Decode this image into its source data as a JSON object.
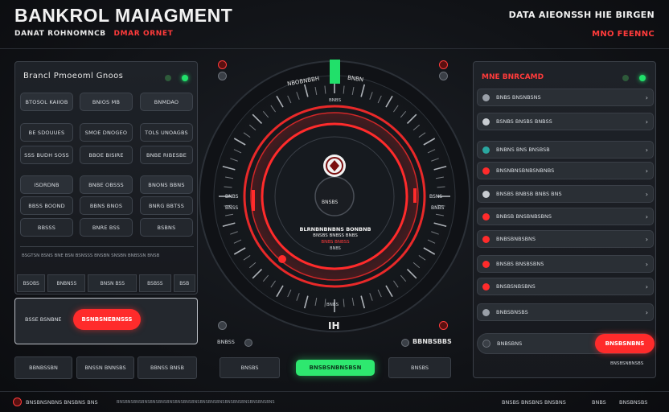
{
  "header": {
    "title": "BANKROL MAIAGMENT",
    "subtitle_white": "DANAT ROHNOMNCB",
    "subtitle_red": "DMAR ORNET",
    "right_top": "DATA AIEONSSH HIE BIRGEN",
    "right_bottom": "MNO FEENNC"
  },
  "left_panel": {
    "title": "Brancl Pmoeoml Gnoos",
    "buttons": [
      "BTOSOL KAIIOB",
      "BNIOS MB",
      "BNMDAO",
      "BE SDOUUES",
      "SMOE DNOGEO",
      "TOLS UNOAGBS",
      "SSS BUDH SOSS",
      "BBOE BISIRE",
      "BNBE RIBESBE",
      "ISDRDNB",
      "BNBE OBSSS",
      "BNONS BBNS",
      "BBSS BOOND",
      "BBNS BNOS",
      "BNRG BBTSS",
      "BBSSS",
      "BNRE BSS",
      "BSBNS"
    ],
    "footnote": "BSGTSN BSNS BNE BSN BSNSSS BNSBN SNSBN BNBSSN BNSB",
    "tabs": [
      "BSOBS",
      "BNBNSS",
      "BNSN BSS",
      "BSBSS",
      "BSB"
    ]
  },
  "action_panel": {
    "label": "BSSE BSNBNE",
    "cta": "BSNBSNEBNSSS"
  },
  "left_bottom_buttons": [
    "BBNBSSBN",
    "BNSSN BNNSBS",
    "BBNSS BNSB"
  ],
  "dial": {
    "top_label": "NBOBNBBH",
    "top_label_right": "BNBN",
    "inner_top": "BNBS",
    "left_label_1": "BNBS",
    "left_label_2": "BNSS",
    "right_label_1": "BSNS",
    "right_label_2": "BNBS",
    "center_label": "BNSBS",
    "readout_1": "BLRNBNBNBNS BONBNB",
    "readout_2": "BNSBS BNBSS BNBS",
    "readout_3": "BNBS BNBSS",
    "readout_4": "BNBS",
    "bottom_small": "BNBS",
    "bottom_big": "IH",
    "accent_red": "#ff2b2b",
    "accent_green": "#21e06a"
  },
  "center_bottom": {
    "left_status": "BNBSS",
    "right_status": "BBNBSBBS",
    "buttons": [
      "BNSBS",
      "BNSBSNBNSBSN",
      "BNSBS"
    ]
  },
  "right_panel": {
    "title": "MNE BNRCAMD",
    "items": [
      {
        "label": "BNBS BNSNBSNS",
        "icon_color": "#9aa0a8"
      },
      {
        "label": "BSNBS    BNSBS BNBSS",
        "icon_color": "#c8ccd1"
      },
      {
        "label": "BNBNS BNS BNSBSB",
        "icon_color": "#2aa7a0"
      },
      {
        "label": "BNSNBNSBNBSNBNBS",
        "icon_color": "#ff2b2b"
      },
      {
        "label": "BNSBS   BNBSB  BNBS BNS",
        "icon_color": "#c8ccd1"
      },
      {
        "label": "BNBSB BNSBNBSBNS",
        "icon_color": "#ff2b2b"
      },
      {
        "label": "BNBSBNBSBNS",
        "icon_color": "#ff2b2b"
      },
      {
        "label": "BNSBS   BNSBSBNS",
        "icon_color": "#ff2b2b"
      },
      {
        "label": "BNSBSNBSBNS",
        "icon_color": "#ff2b2b"
      },
      {
        "label": "BNBSBNSBS",
        "icon_color": "#9aa0a8"
      }
    ],
    "last_label": "BNBSBNS",
    "last_cta": "BNSBSNBNS",
    "footer": "BNSBSNBNSBS"
  },
  "footer": {
    "left": "BNSBNSNBNS BNSBNS BNS",
    "middle": "BNSBNSBNSBNSBNSBNSBNSBNSBNSBNSBNSBNSBNSBNSBNSBNSBNSBNSBNS",
    "right_1": "BNSBS BNSBNS BNSBNS",
    "right_2": "BNBS",
    "right_3": "BNSBNSBS"
  }
}
